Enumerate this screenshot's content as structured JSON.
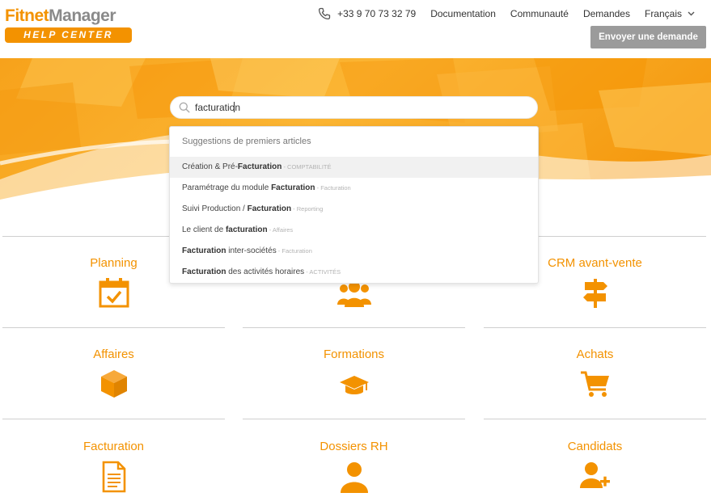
{
  "header": {
    "logo_part1": "Fitnet",
    "logo_part2": "Manager",
    "logo_badge": "HELP CENTER",
    "phone": "+33 9 70 73 32 79",
    "nav": [
      "Documentation",
      "Communauté",
      "Demandes"
    ],
    "language": "Français",
    "send_request": "Envoyer une demande"
  },
  "search": {
    "value": "facturation",
    "placeholder": ""
  },
  "suggestions": {
    "title": "Suggestions de premiers articles",
    "items": [
      {
        "before": "Création & Pré-",
        "bold": "Facturation",
        "after": "",
        "category": " - COMPTABILITÉ"
      },
      {
        "before": "Paramétrage du module ",
        "bold": "Facturation",
        "after": "",
        "category": " - Facturation"
      },
      {
        "before": "Suivi Production / ",
        "bold": "Facturation",
        "after": "",
        "category": " - Reporting"
      },
      {
        "before": "Le client de ",
        "bold": "facturation",
        "after": "",
        "category": " - Affaires"
      },
      {
        "before": "",
        "bold": "Facturation",
        "after": " inter-sociétés",
        "category": " - Facturation"
      },
      {
        "before": "",
        "bold": "Facturation",
        "after": " des activités horaires",
        "category": " - ACTIVITÉS"
      }
    ]
  },
  "categories": [
    {
      "title": "Planning",
      "icon": "calendar-check-icon"
    },
    {
      "title": "",
      "icon": "users-group-icon"
    },
    {
      "title": "CRM avant-vente",
      "icon": "signpost-icon"
    },
    {
      "title": "Affaires",
      "icon": "cube-icon"
    },
    {
      "title": "Formations",
      "icon": "graduation-cap-icon"
    },
    {
      "title": "Achats",
      "icon": "shopping-cart-icon"
    },
    {
      "title": "Facturation",
      "icon": "document-icon"
    },
    {
      "title": "Dossiers RH",
      "icon": "user-icon"
    },
    {
      "title": "Candidats",
      "icon": "user-plus-icon"
    }
  ],
  "colors": {
    "accent": "#f39200",
    "logo_gray": "#8a8a8a",
    "button_gray": "#9b9b9b"
  }
}
